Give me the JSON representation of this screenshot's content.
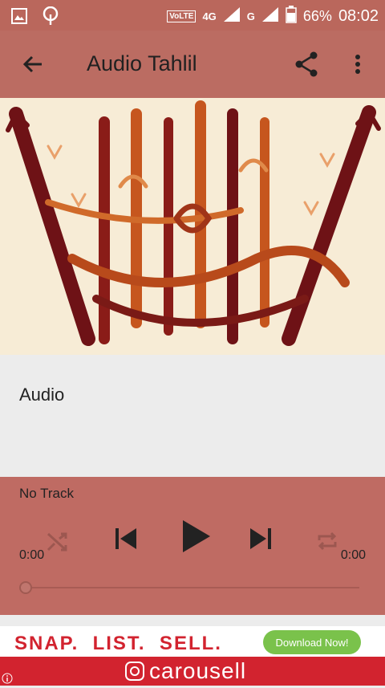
{
  "statusbar": {
    "volte": "VoLTE",
    "network_4g": "4G",
    "network_g": "G",
    "battery": "66%",
    "time": "08:02",
    "icons": [
      "image-icon",
      "tree-icon",
      "signal-icon",
      "battery-icon"
    ]
  },
  "appbar": {
    "title": "Audio Tahlil",
    "icons": [
      "back-arrow-icon",
      "share-icon",
      "more-vert-icon"
    ]
  },
  "artwork": {
    "description": "arabic-calligraphy-image"
  },
  "content": {
    "label": "Audio"
  },
  "player": {
    "track": "No Track",
    "elapsed": "0:00",
    "duration": "0:00",
    "progress": 0,
    "icons": [
      "shuffle-icon",
      "skip-previous-icon",
      "play-icon",
      "skip-next-icon",
      "repeat-icon"
    ]
  },
  "ad": {
    "slogan": "SNAP.  LIST.  SELL.",
    "cta": "Download Now!",
    "brand": "carousell",
    "icons": [
      "carousell-logo-icon",
      "info-icon"
    ]
  },
  "colors": {
    "appbar": "#bb6c62",
    "player": "#bf6b63",
    "ad_red": "#d2232f",
    "ad_green": "#7ac24b"
  }
}
